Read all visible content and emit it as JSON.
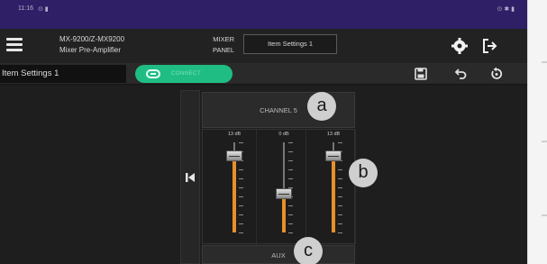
{
  "status_bar": {
    "time": "11:16",
    "signal": "⊙ ▮",
    "right_icons": "⊙ ✱ ▮"
  },
  "header": {
    "model_line1": "MX-9200/Z-MX9200",
    "model_line2": "Mixer Pre-Amplifier",
    "mode_line1": "MIXER",
    "mode_line2": "PANEL",
    "settings_name": "Item Settings 1"
  },
  "toolbar": {
    "item_name": "Item Settings 1",
    "connect_label": "CONNECT"
  },
  "mixer": {
    "channel_title": "CHANNEL 5",
    "bottom_label": "AUX",
    "faders": [
      {
        "level_label": "13 dB",
        "level": 0.9
      },
      {
        "level_label": "0 dB",
        "level": 0.42
      },
      {
        "level_label": "13 dB",
        "level": 0.9
      }
    ]
  },
  "callouts": {
    "a": "a",
    "b": "b",
    "c": "c"
  },
  "colors": {
    "accent_green": "#1fbd84",
    "fader_fill": "#e6902a",
    "status_bar": "#2f1f66"
  }
}
